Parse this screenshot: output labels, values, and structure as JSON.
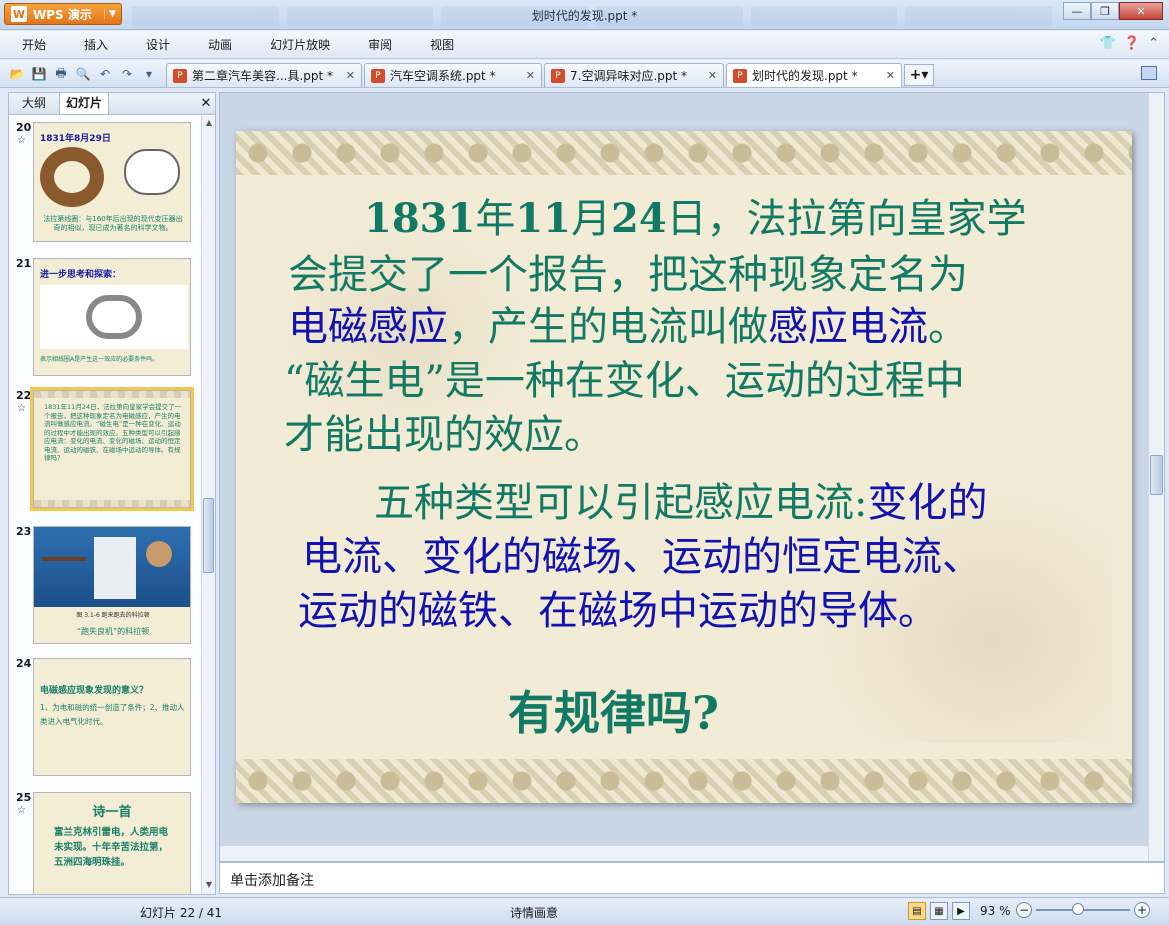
{
  "app": {
    "name": "WPS 演示",
    "window_title": "划时代的发现.ppt *"
  },
  "menu": [
    "开始",
    "插入",
    "设计",
    "动画",
    "幻灯片放映",
    "审阅",
    "视图"
  ],
  "doc_tabs": [
    {
      "label": "第二章汽车美容...具.ppt *",
      "active": false
    },
    {
      "label": "汽车空调系统.ppt *",
      "active": false
    },
    {
      "label": "7.空调异味对应.ppt *",
      "active": false
    },
    {
      "label": "划时代的发现.ppt *",
      "active": true
    }
  ],
  "left_panel": {
    "tabs": [
      "大纲",
      "幻灯片"
    ],
    "active_tab": "幻灯片",
    "thumbs": [
      {
        "num": "20",
        "star": true,
        "title": "1831年8月29日",
        "text": "法拉第线圈：与160年后出现的现代变压器出奇的相似，现已成为著名的科学文物。"
      },
      {
        "num": "21",
        "star": false,
        "title": "进一步思考和探索：",
        "text": "表示相线圈A是产生这一效应的必要条件吗。"
      },
      {
        "num": "22",
        "star": true,
        "title": "",
        "text": "1831年11月24日，法拉第向皇家学会提交了一个报告，把这种现象定名为电磁感应，产生的电流叫做感应电流。“磁生电”是一种在变化、运动的过程中才能出现的效应。五种类型可以引起感应电流：变化的电流、变化的磁场、运动的恒定电流、运动的磁铁、在磁场中运动的导体。有规律吗？"
      },
      {
        "num": "23",
        "star": false,
        "title": "",
        "text": "“跑失良机”的科拉顿"
      },
      {
        "num": "24",
        "star": false,
        "title": "电磁感应现象发现的意义？",
        "text": "1、为电和磁的统一创造了条件；2、推动人类进入电气化时代。"
      },
      {
        "num": "25",
        "star": true,
        "title": "诗一首",
        "text": "富兰克林引雷电，人类用电未实现。十年辛苦法拉第，五洲四海明珠挂。"
      }
    ]
  },
  "slide": {
    "p1": [
      {
        "num": "1831",
        "t1": "年",
        "n2": "11",
        "t2": "月",
        "n3": "24",
        "t3": "日，法拉第向皇家学"
      },
      "会提交了一个报告，把这种现象定名为",
      {
        "blue1": "电磁感应",
        "mid": "，产生的电流叫做",
        "blue2": "感应电流",
        "end": "。"
      },
      "“磁生电”是一种在变化、运动的过程中",
      "才能出现的效应。"
    ],
    "p2": [
      {
        "green": "五种类型可以引起感应电流:",
        "blue": "变化的"
      },
      "电流、变化的磁场、运动的恒定电流、",
      "运动的磁铁、在磁场中运动的导体。"
    ],
    "question": "有规律吗?"
  },
  "notes_placeholder": "单击添加备注",
  "status": {
    "slide_pos": "幻灯片 22 / 41",
    "theme": "诗情画意",
    "zoom": "93 %"
  },
  "colors": {
    "slide_green": "#127a64",
    "slide_blue": "#1212b0",
    "accent_orange": "#e2741a"
  }
}
